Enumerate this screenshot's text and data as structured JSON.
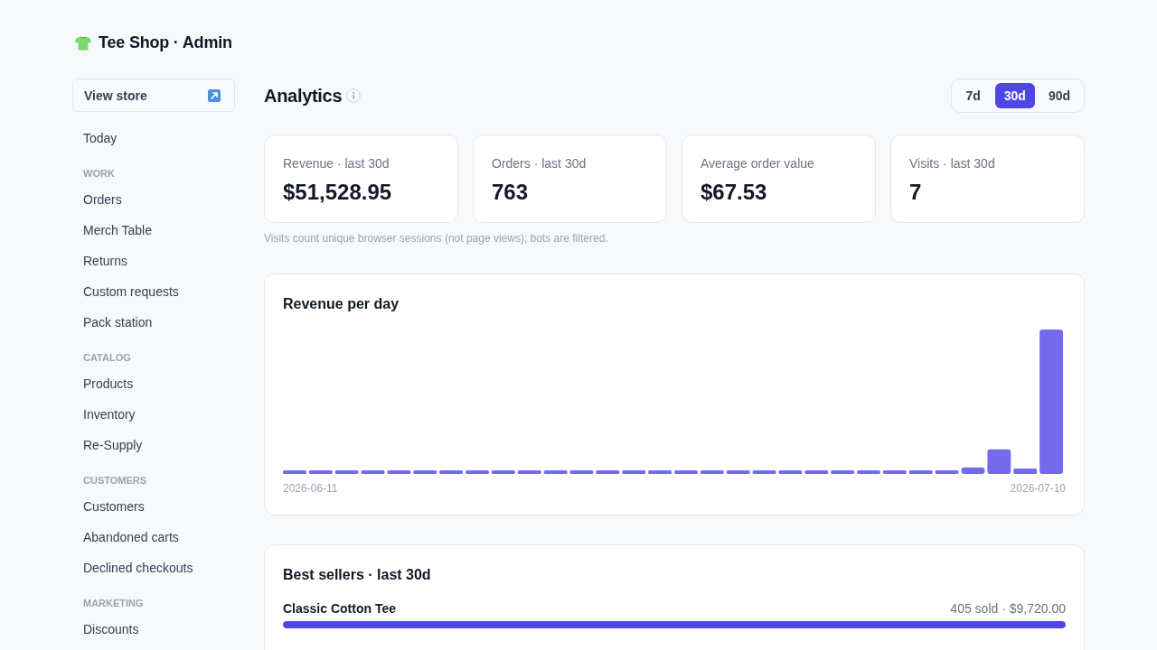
{
  "brand": {
    "title": "Tee Shop · Admin"
  },
  "sidebar": {
    "view_store": {
      "label": "View store"
    },
    "groups": [
      {
        "items": [
          {
            "label": "Today",
            "selected": false
          }
        ]
      },
      {
        "heading": "WORK",
        "items": [
          {
            "label": "Orders",
            "selected": false
          },
          {
            "label": "Merch Table",
            "selected": false
          },
          {
            "label": "Returns",
            "selected": false
          },
          {
            "label": "Custom requests",
            "selected": false
          },
          {
            "label": "Pack station",
            "selected": false
          }
        ]
      },
      {
        "heading": "CATALOG",
        "items": [
          {
            "label": "Products",
            "selected": false
          },
          {
            "label": "Inventory",
            "selected": false
          },
          {
            "label": "Re-Supply",
            "selected": false
          }
        ]
      },
      {
        "heading": "CUSTOMERS",
        "items": [
          {
            "label": "Customers",
            "selected": false
          },
          {
            "label": "Abandoned carts",
            "selected": false
          },
          {
            "label": "Declined checkouts",
            "selected": false
          }
        ]
      },
      {
        "heading": "MARKETING",
        "items": [
          {
            "label": "Discounts",
            "selected": false
          }
        ]
      }
    ]
  },
  "main": {
    "title": "Analytics",
    "ranges": [
      {
        "label": "7d",
        "selected": false
      },
      {
        "label": "30d",
        "selected": true
      },
      {
        "label": "90d",
        "selected": false
      }
    ],
    "stats": [
      {
        "label": "Revenue · last 30d",
        "value": "$51,528.95"
      },
      {
        "label": "Orders · last 30d",
        "value": "763"
      },
      {
        "label": "Average order value",
        "value": "$67.53"
      },
      {
        "label": "Visits · last 30d",
        "value": "7"
      }
    ],
    "note": "Visits count unique browser sessions (not page views); bots are filtered.",
    "revenue_chart": {
      "title": "Revenue per day",
      "start_label": "2026-06-11",
      "end_label": "2026-07-10"
    },
    "best_sellers": {
      "title": "Best sellers · last 30d",
      "rows": [
        {
          "name": "Classic Cotton Tee",
          "summary": "405 sold · $9,720.00",
          "level": 1
        }
      ]
    }
  }
}
